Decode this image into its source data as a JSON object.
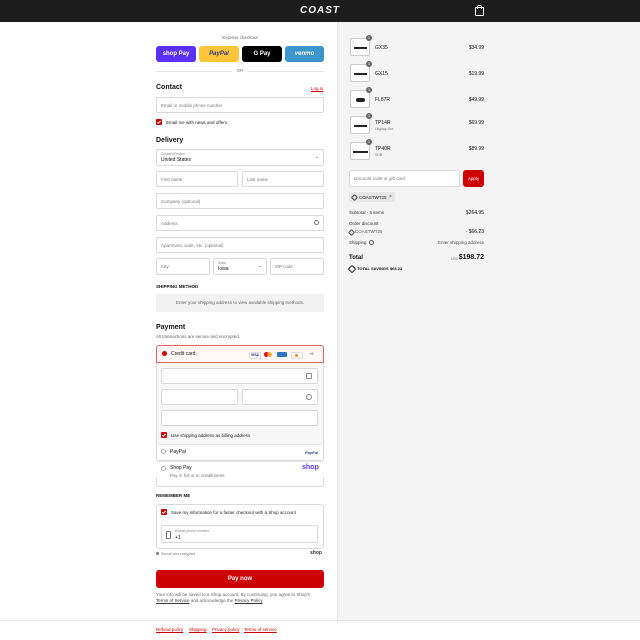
{
  "header": {
    "logo": "COAST",
    "bag_icon": "shopping-bag-icon"
  },
  "express": {
    "label": "Express checkout",
    "buttons": [
      {
        "label": "shop Pay",
        "color": "#5a31f4",
        "text": "#ffffff"
      },
      {
        "label": "PayPal",
        "color": "#ffc439",
        "text": "#253b80"
      },
      {
        "label": "G Pay",
        "color": "#000000",
        "text": "#ffffff"
      },
      {
        "label": "venmo",
        "color": "#3d95ce",
        "text": "#ffffff"
      }
    ],
    "or": "OR"
  },
  "contact": {
    "title": "Contact",
    "login": "Log in",
    "phone_placeholder": "Email or mobile phone number",
    "news_label": "Email me with news and offers"
  },
  "delivery": {
    "title": "Delivery",
    "country_label": "Country/Region",
    "country_value": "United States",
    "first_name": "First name",
    "last_name": "Last name",
    "company": "Company (optional)",
    "address": "Address",
    "apartment": "Apartment, suite, etc. (optional)",
    "city": "City",
    "state_label": "State",
    "state_value": "Iowa",
    "zip": "ZIP code"
  },
  "shipping": {
    "title": "SHIPPING METHOD",
    "message": "Enter your shipping address to view available shipping methods."
  },
  "payment": {
    "title": "Payment",
    "subtitle": "All transactions are secure and encrypted.",
    "credit_card": "Credit card",
    "more_cards": "+5",
    "billing_label": "Use shipping address as billing address",
    "paypal": "PayPal",
    "paypal_logo": "PayPal",
    "shop_pay": "Shop Pay",
    "shop_pay_sub": "Pay in full or in installments",
    "shop_logo": "shop"
  },
  "remember": {
    "title": "REMEMBER ME",
    "save_label": "Save my information for a faster checkout with a Shop account",
    "phone_label": "Mobile phone number",
    "phone_value": "+1",
    "secure": "Secure and encrypted",
    "shop": "shop"
  },
  "pay_button": "Pay now",
  "disclaimer_line1": "Your info will be saved to a Shop account. By continuing, you agree to Shop's",
  "disclaimer_tos": "Terms of Service",
  "disclaimer_mid": "and acknowledge the",
  "disclaimer_privacy": "Privacy Policy",
  "footer": [
    "Refund policy",
    "Shipping",
    "Privacy policy",
    "Terms of service"
  ],
  "cart": {
    "items": [
      {
        "name": "GX35",
        "sub": "",
        "price": "$34.99",
        "qty": "1"
      },
      {
        "name": "GX15",
        "sub": "",
        "price": "$19.99",
        "qty": "1"
      },
      {
        "name": "FL87R",
        "sub": "",
        "price": "$49.99",
        "qty": "1"
      },
      {
        "name": "TP14R",
        "sub": "Display Box",
        "price": "$69.99",
        "qty": "1"
      },
      {
        "name": "TP40R",
        "sub": "SDB",
        "price": "$89.99",
        "qty": "1"
      }
    ],
    "discount_placeholder": "Discount code or gift card",
    "apply": "Apply",
    "code_chip": "COASTWT25",
    "subtotal_label": "Subtotal · 5 items",
    "subtotal_value": "$264.95",
    "order_discount_label": "Order discount",
    "discount_code": "COASTWT25",
    "discount_value": "- $66.23",
    "shipping_label": "Shipping",
    "shipping_value": "Enter shipping address",
    "total_label": "Total",
    "currency": "USD",
    "total_value": "$198.72",
    "savings_label": "TOTAL SAVINGS",
    "savings_value": "$66.23"
  },
  "colors": {
    "accent": "#cc0000",
    "shop_purple": "#5a31f4"
  }
}
